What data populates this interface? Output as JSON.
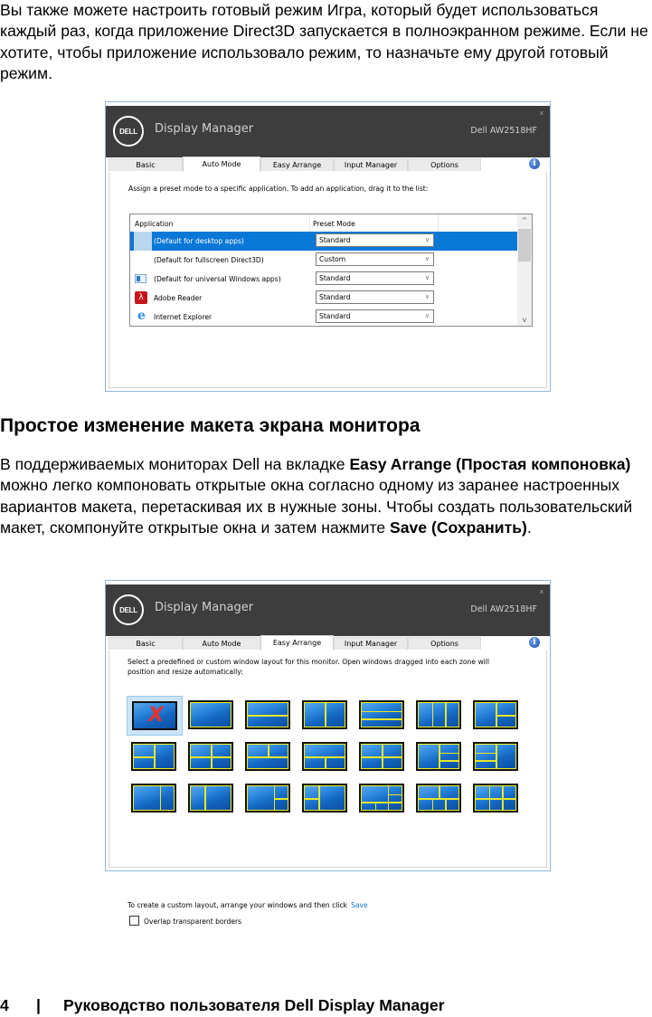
{
  "intro_paragraph": "Вы также можете настроить готовый режим Игра, который будет использоваться каждый раз, когда приложение Direct3D запускается в полноэкранном режиме. Если не хотите, чтобы приложение использовало режим, то назначьте ему другой готовый режим.",
  "section_heading": "Простое изменение макета экрана монитора",
  "section_paragraph": {
    "part1": "В поддерживаемых мониторах Dell на вкладке ",
    "bold1": "Easy Arrange (Простая компоновка)",
    "part2": " можно легко компоновать открытые окна согласно одному из заранее настроенных вариантов макета, перетаскивая их в нужные зоны. Чтобы создать пользовательский макет, скомпонуйте открытые окна и затем нажмите ",
    "bold2": "Save (Сохранить)",
    "part3": "."
  },
  "footer": {
    "page_number": "4",
    "separator": "|",
    "title": "Руководство пользователя Dell Display Manager"
  },
  "app": {
    "logo_text": "DELL",
    "title": "Display Manager",
    "model": "Dell AW2518HF",
    "close_glyph": "x",
    "info_glyph": "i",
    "tabs": [
      "Basic",
      "Auto Mode",
      "Easy Arrange",
      "Input Manager",
      "Options"
    ]
  },
  "auto_mode_window": {
    "active_tab": "Auto Mode",
    "description": "Assign a preset mode to a specific application.  To add an application, drag it to the list:",
    "columns": [
      "Application",
      "Preset Mode"
    ],
    "rows": [
      {
        "icon": "desktop-apps-icon",
        "name": "(Default for desktop apps)",
        "mode": "Standard",
        "selected": true
      },
      {
        "icon": "",
        "name": "(Default for fullscreen Direct3D)",
        "mode": "Custom",
        "selected": false
      },
      {
        "icon": "universal-apps-icon",
        "name": "(Default for universal Windows apps)",
        "mode": "Standard",
        "selected": false
      },
      {
        "icon": "adobe-reader-icon",
        "name": "Adobe Reader",
        "mode": "Standard",
        "selected": false
      },
      {
        "icon": "internet-explorer-icon",
        "name": "Internet Explorer",
        "mode": "Standard",
        "selected": false
      }
    ],
    "scroll_up": "^",
    "scroll_down": "v",
    "chevron": "∨"
  },
  "easy_arrange_window": {
    "active_tab": "Easy Arrange",
    "description_line1": "Select a predefined or custom window layout for this monitor.  Open windows dragged into each zone will",
    "description_line2": "position and resize automatically:",
    "layouts": [
      {
        "name": "none",
        "selected": true
      },
      {
        "name": "full"
      },
      {
        "name": "top-bottom"
      },
      {
        "name": "left-right"
      },
      {
        "name": "three-rows"
      },
      {
        "name": "three-columns"
      },
      {
        "name": "left-plus-right-split"
      },
      {
        "name": "left-split-plus-right"
      },
      {
        "name": "quad-left-narrow"
      },
      {
        "name": "top-split-bottom"
      },
      {
        "name": "top-bottom-split"
      },
      {
        "name": "quad"
      },
      {
        "name": "left-plus-right-three"
      },
      {
        "name": "left-two-plus-right"
      },
      {
        "name": "left-wide-right-narrow"
      },
      {
        "name": "narrow-left-wide-right"
      },
      {
        "name": "right-narrow-split"
      },
      {
        "name": "left-narrow-split"
      },
      {
        "name": "complex-five"
      },
      {
        "name": "top-split-bottom-three"
      },
      {
        "name": "six-grid"
      }
    ],
    "custom_text": "To create a custom layout, arrange your windows and then click",
    "save_link": "Save",
    "overlap_label": "Overlap transparent borders",
    "overlap_checked": false
  }
}
